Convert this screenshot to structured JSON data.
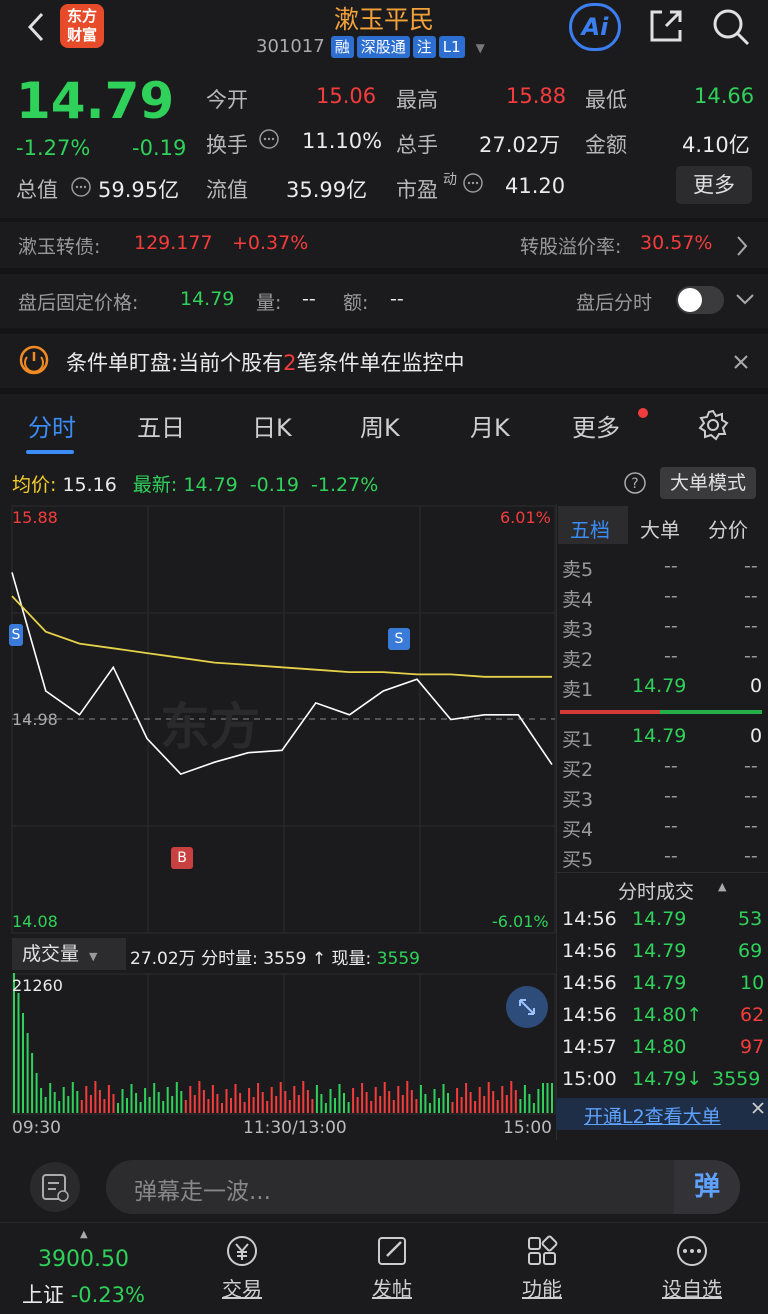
{
  "header": {
    "stock_name": "漱玉平民",
    "stock_code": "301017",
    "tags": [
      "融",
      "深股通",
      "注",
      "L1"
    ],
    "logo_text_1": "东方",
    "logo_text_2": "财富",
    "ai_label": "Ai"
  },
  "quote": {
    "price": "14.79",
    "change_pct": "-1.27%",
    "change": "-0.19",
    "open_label": "今开",
    "open": "15.06",
    "high_label": "最高",
    "high": "15.88",
    "low_label": "最低",
    "low": "14.66",
    "turnover_label": "换手",
    "turnover": "11.10%",
    "volume_label": "总手",
    "volume": "27.02万",
    "amount_label": "金额",
    "amount": "4.10亿",
    "mktcap_label": "总值",
    "mktcap": "59.95亿",
    "float_label": "流值",
    "float_cap": "35.99亿",
    "pe_label": "市盈",
    "pe_sup": "动",
    "pe": "41.20",
    "more_button": "更多"
  },
  "convertible": {
    "name": "漱玉转债:",
    "price": "129.177",
    "change": "+0.37%",
    "premium_label": "转股溢价率:",
    "premium": "30.57%"
  },
  "after_hours": {
    "price_label": "盘后固定价格:",
    "price": "14.79",
    "volume_label": "量:",
    "volume": "--",
    "amount_label": "额:",
    "amount": "--",
    "timeshare_label": "盘后分时",
    "toggle_on": false
  },
  "alert": {
    "text_before": "条件单盯盘:当前个股有",
    "count": "2",
    "text_after": "笔条件单在监控中"
  },
  "tabs": [
    {
      "label": "分时",
      "active": true
    },
    {
      "label": "五日",
      "active": false
    },
    {
      "label": "日K",
      "active": false
    },
    {
      "label": "周K",
      "active": false
    },
    {
      "label": "月K",
      "active": false
    },
    {
      "label": "更多",
      "active": false
    }
  ],
  "chart_info": {
    "avg_label": "均价:",
    "avg": "15.16",
    "latest_label": "最新:",
    "latest": "14.79",
    "latest_change": "-0.19",
    "latest_pct": "-1.27%",
    "bigorder_button": "大单模式",
    "y_top": "15.88",
    "y_mid": "14.98",
    "y_bottom": "14.08",
    "pct_top": "6.01%",
    "pct_bottom": "-6.01%",
    "buy_marker": "B",
    "sell_marker": "S",
    "volume_selector": "成交量",
    "volume_total": "27.02万",
    "volume_period_label": "分时量:",
    "volume_period": "3559",
    "current_volume_label": "现量:",
    "current_volume": "3559",
    "volume_max": "21260",
    "time_start": "09:30",
    "time_mid": "11:30/13:00",
    "time_end": "15:00"
  },
  "chart_data": {
    "type": "line",
    "x": [
      "09:30",
      "09:45",
      "10:00",
      "10:15",
      "10:30",
      "10:45",
      "11:00",
      "11:15",
      "11:30",
      "13:15",
      "13:30",
      "13:45",
      "14:00",
      "14:15",
      "14:30",
      "14:45",
      "15:00"
    ],
    "series": [
      {
        "values": [
          15.6,
          15.1,
          15.0,
          15.2,
          14.9,
          14.75,
          14.8,
          14.84,
          14.85,
          15.05,
          15.0,
          15.1,
          15.15,
          14.98,
          15.0,
          15.0,
          14.79
        ]
      },
      {
        "values": [
          15.5,
          15.35,
          15.3,
          15.28,
          15.26,
          15.24,
          15.22,
          15.21,
          15.2,
          15.19,
          15.18,
          15.18,
          15.17,
          15.17,
          15.16,
          15.16,
          15.16
        ]
      }
    ],
    "ylim": [
      14.08,
      15.88
    ]
  },
  "orderbook": {
    "tabs": [
      "五档",
      "大单",
      "分价"
    ],
    "asks": [
      {
        "label": "卖5",
        "price": "--",
        "vol": "--"
      },
      {
        "label": "卖4",
        "price": "--",
        "vol": "--"
      },
      {
        "label": "卖3",
        "price": "--",
        "vol": "--"
      },
      {
        "label": "卖2",
        "price": "--",
        "vol": "--"
      },
      {
        "label": "卖1",
        "price": "14.79",
        "vol": "0"
      }
    ],
    "bids": [
      {
        "label": "买1",
        "price": "14.79",
        "vol": "0"
      },
      {
        "label": "买2",
        "price": "--",
        "vol": "--"
      },
      {
        "label": "买3",
        "price": "--",
        "vol": "--"
      },
      {
        "label": "买4",
        "price": "--",
        "vol": "--"
      },
      {
        "label": "买5",
        "price": "--",
        "vol": "--"
      }
    ],
    "trades_title": "分时成交",
    "trades": [
      {
        "time": "14:56",
        "price": "14.79",
        "vol": "53",
        "dir": ""
      },
      {
        "time": "14:56",
        "price": "14.79",
        "vol": "69",
        "dir": ""
      },
      {
        "time": "14:56",
        "price": "14.79",
        "vol": "10",
        "dir": ""
      },
      {
        "time": "14:56",
        "price": "14.80↑",
        "vol": "62",
        "dir": "up"
      },
      {
        "time": "14:57",
        "price": "14.80",
        "vol": "97",
        "dir": "up"
      },
      {
        "time": "15:00",
        "price": "14.79↓",
        "vol": "3559",
        "dir": "down"
      }
    ],
    "l2_link": "开通L2查看大单"
  },
  "danmaku": {
    "placeholder": "弹幕走一波...",
    "send_label": "弹"
  },
  "bottom_nav": {
    "index_value": "3900.50",
    "index_name": "上证",
    "index_change": "-0.23%",
    "items": [
      {
        "label": "交易",
        "icon": "trade-icon"
      },
      {
        "label": "发帖",
        "icon": "post-icon"
      },
      {
        "label": "功能",
        "icon": "function-icon"
      },
      {
        "label": "设自选",
        "icon": "watchlist-icon"
      }
    ]
  },
  "colors": {
    "up": "#f43c3c",
    "down": "#2fd15a",
    "avg": "#e6d24a",
    "accent": "#2d6fd0"
  }
}
